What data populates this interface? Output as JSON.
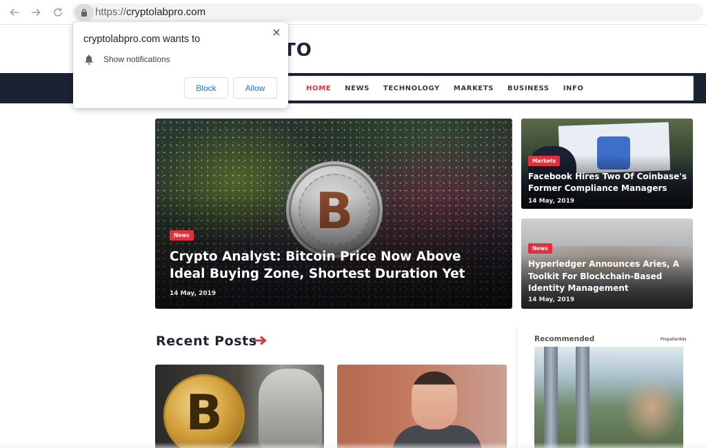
{
  "browser": {
    "url_scheme": "https://",
    "url_host": "cryptolabpro.com"
  },
  "site": {
    "logo_text": "TO",
    "menu": [
      {
        "label": "HOME",
        "active": true
      },
      {
        "label": "NEWS"
      },
      {
        "label": "TECHNOLOGY"
      },
      {
        "label": "MARKETS"
      },
      {
        "label": "BUSINESS"
      },
      {
        "label": "INFO"
      }
    ],
    "accent_color": "#e0313c",
    "nav_color": "#1b2333"
  },
  "featured": {
    "main": {
      "category": "News",
      "title": "Crypto Analyst: Bitcoin Price Now Above Ideal Buying Zone, Shortest Duration Yet",
      "date": "14 May, 2019",
      "coin_symbol": "B"
    },
    "side": [
      {
        "category": "Markets",
        "title": "Facebook Hires Two Of Coinbase's Former Compliance Managers",
        "date": "14 May, 2019"
      },
      {
        "category": "News",
        "title": "Hyperledger Announces Aries, A Toolkit For Blockchain-Based Identity Management",
        "date": "14 May, 2019"
      }
    ]
  },
  "recent": {
    "heading": "Recent Posts",
    "coin_symbol": "B"
  },
  "sidebar": {
    "recommended_label": "Recommended",
    "brand": "PropellerAds"
  },
  "permission_popup": {
    "title": "cryptolabpro.com wants to",
    "permission": "Show notifications",
    "block_label": "Block",
    "allow_label": "Allow"
  },
  "icons": {
    "back": "back-arrow-icon",
    "forward": "forward-arrow-icon",
    "reload": "reload-icon",
    "lock": "lock-icon",
    "close": "close-icon",
    "bell": "bell-icon",
    "arrow": "arrow-right-icon"
  }
}
